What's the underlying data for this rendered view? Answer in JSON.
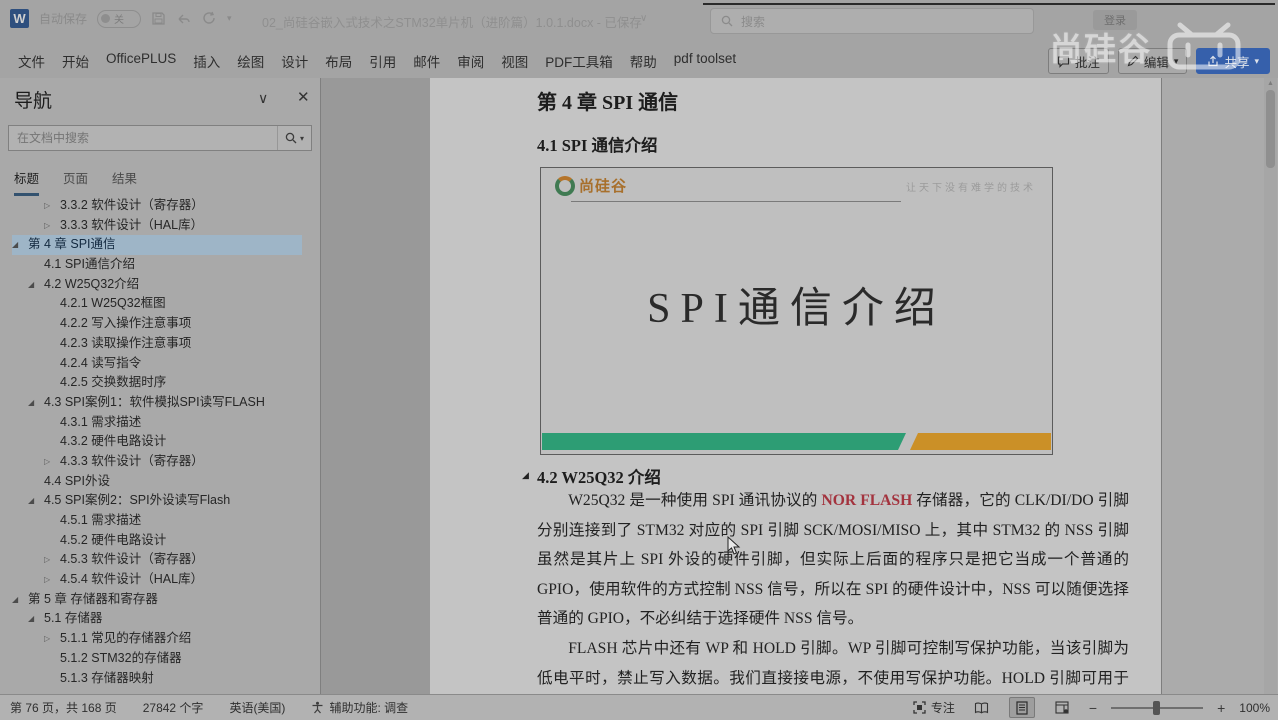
{
  "titlebar": {
    "autosave_label": "自动保存",
    "autosave_state": "关",
    "doc_title": "02_尚硅谷嵌入式技术之STM32单片机（进阶篇）1.0.1.docx - 已保存",
    "search_placeholder": "搜索",
    "signin_label": "登录"
  },
  "ribbon": {
    "tabs": [
      "文件",
      "开始",
      "OfficePLUS",
      "插入",
      "绘图",
      "设计",
      "布局",
      "引用",
      "邮件",
      "审阅",
      "视图",
      "PDF工具箱",
      "帮助",
      "pdf toolset"
    ],
    "comments_label": "批注",
    "edit_label": "编辑",
    "share_label": "共享"
  },
  "watermark": {
    "brand_text": "尚硅谷"
  },
  "nav_pane": {
    "title": "导航",
    "search_placeholder": "在文档中搜索",
    "tabs": [
      {
        "label": "标题",
        "active": true
      },
      {
        "label": "页面",
        "active": false
      },
      {
        "label": "结果",
        "active": false
      }
    ],
    "items": [
      {
        "state": "collapsed",
        "level": 2,
        "label": "3.3.2 软件设计（寄存器）",
        "selected": false
      },
      {
        "state": "collapsed",
        "level": 2,
        "label": "3.3.3 软件设计（HAL库）",
        "selected": false
      },
      {
        "state": "expanded",
        "level": 0,
        "label": "第 4 章 SPI通信",
        "selected": true
      },
      {
        "state": "leaf",
        "level": 1,
        "label": "4.1 SPI通信介绍",
        "selected": false
      },
      {
        "state": "expanded",
        "level": 1,
        "label": "4.2 W25Q32介绍",
        "selected": false
      },
      {
        "state": "leaf",
        "level": 2,
        "label": "4.2.1 W25Q32框图",
        "selected": false
      },
      {
        "state": "leaf",
        "level": 2,
        "label": "4.2.2 写入操作注意事项",
        "selected": false
      },
      {
        "state": "leaf",
        "level": 2,
        "label": "4.2.3 读取操作注意事项",
        "selected": false
      },
      {
        "state": "leaf",
        "level": 2,
        "label": "4.2.4 读写指令",
        "selected": false
      },
      {
        "state": "leaf",
        "level": 2,
        "label": "4.2.5 交换数据时序",
        "selected": false
      },
      {
        "state": "expanded",
        "level": 1,
        "label": "4.3 SPI案例1：软件模拟SPI读写FLASH",
        "selected": false
      },
      {
        "state": "leaf",
        "level": 2,
        "label": "4.3.1 需求描述",
        "selected": false
      },
      {
        "state": "leaf",
        "level": 2,
        "label": "4.3.2 硬件电路设计",
        "selected": false
      },
      {
        "state": "collapsed",
        "level": 2,
        "label": "4.3.3 软件设计（寄存器）",
        "selected": false
      },
      {
        "state": "leaf",
        "level": 1,
        "label": "4.4 SPI外设",
        "selected": false
      },
      {
        "state": "expanded",
        "level": 1,
        "label": "4.5 SPI案例2：SPI外设读写Flash",
        "selected": false
      },
      {
        "state": "leaf",
        "level": 2,
        "label": "4.5.1 需求描述",
        "selected": false
      },
      {
        "state": "leaf",
        "level": 2,
        "label": "4.5.2 硬件电路设计",
        "selected": false
      },
      {
        "state": "collapsed",
        "level": 2,
        "label": "4.5.3 软件设计（寄存器）",
        "selected": false
      },
      {
        "state": "collapsed",
        "level": 2,
        "label": "4.5.4 软件设计（HAL库）",
        "selected": false
      },
      {
        "state": "expanded",
        "level": 0,
        "label": "第 5 章 存储器和寄存器",
        "selected": false
      },
      {
        "state": "expanded",
        "level": 1,
        "label": "5.1 存储器",
        "selected": false
      },
      {
        "state": "collapsed",
        "level": 2,
        "label": "5.1.1 常见的存储器介绍",
        "selected": false
      },
      {
        "state": "leaf",
        "level": 2,
        "label": "5.1.2 STM32的存储器",
        "selected": false
      },
      {
        "state": "leaf",
        "level": 2,
        "label": "5.1.3 存储器映射",
        "selected": false
      }
    ]
  },
  "document": {
    "chapter_heading": "第 4 章 SPI 通信",
    "section_heading_1": "4.1 SPI 通信介绍",
    "slide": {
      "brand": "尚硅谷",
      "tagline": "让天下没有难学的技术",
      "title": "SPI通信介绍"
    },
    "section_heading_2": "4.2 W25Q32 介绍",
    "para1_pre": "W25Q32 是一种使用 SPI 通讯协议的 ",
    "para1_highlight": "NOR FLASH",
    "para1_post": " 存储器，它的 CLK/DI/DO 引脚分别连接到了 STM32 对应的 SPI 引脚 SCK/MOSI/MISO 上，其中 STM32 的 NSS 引脚虽然是其片上 SPI 外设的硬件引脚，但实际上后面的程序只是把它当成一个普通的 GPIO，使用软件的方式控制 NSS 信号，所以在 SPI 的硬件设计中，NSS 可以随便选择普通的 GPIO，不必纠结于选择硬件 NSS 信号。",
    "para2": "FLASH 芯片中还有 WP 和 HOLD 引脚。WP 引脚可控制写保护功能，当该引脚为低电平时，禁止写入数据。我们直接接电源，不使用写保护功能。HOLD 引脚可用于暂停通讯，"
  },
  "statusbar": {
    "page_info": "第 76 页，共 168 页",
    "word_count": "27842 个字",
    "language": "英语(美国)",
    "accessibility": "辅助功能: 调查",
    "focus_label": "专注",
    "zoom_value": "100%"
  },
  "colors": {
    "nav_selection": "#9eb5c7",
    "share_button": "#3660ab",
    "highlight_red": "#a3333e",
    "slide_green": "#2d9d74",
    "slide_orange": "#cb9027",
    "logo_green": "#3f7a52",
    "logo_orange": "#a8702c"
  }
}
